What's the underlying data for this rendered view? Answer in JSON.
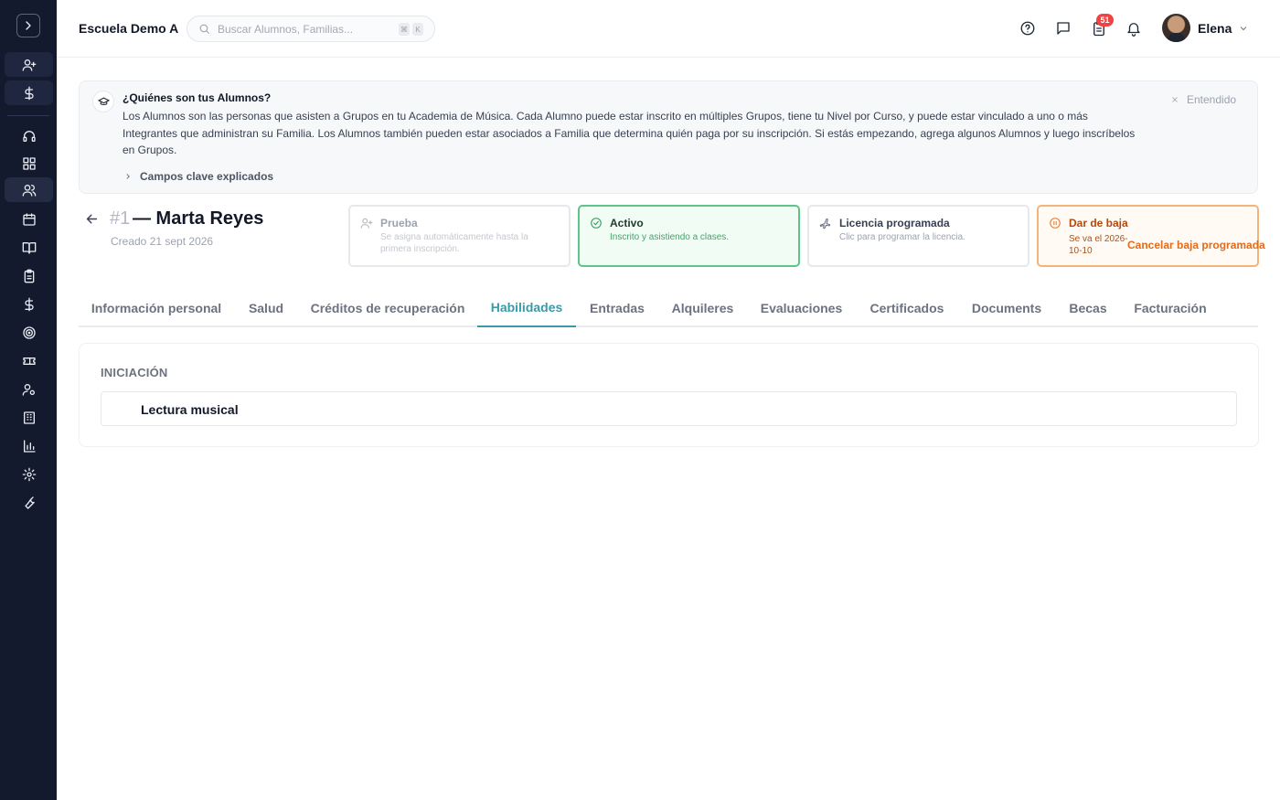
{
  "app": {
    "school_name": "Escuela Demo A",
    "search": {
      "placeholder": "Buscar Alumnos, Familias...",
      "shortcut_keys": [
        "⌘",
        "K"
      ]
    },
    "notifications_count": "51",
    "user": {
      "name": "Elena"
    }
  },
  "sidebar": {
    "items": [
      {
        "icon": "user-plus-icon"
      },
      {
        "icon": "dollar-icon"
      },
      {
        "icon": "headset-icon"
      },
      {
        "icon": "dashboard-grid-icon"
      },
      {
        "icon": "users-icon",
        "active": true
      },
      {
        "icon": "calendar-icon"
      },
      {
        "icon": "book-open-icon"
      },
      {
        "icon": "clipboard-icon"
      },
      {
        "icon": "dollar-icon"
      },
      {
        "icon": "target-icon"
      },
      {
        "icon": "ticket-icon"
      },
      {
        "icon": "user-settings-icon"
      },
      {
        "icon": "building-icon"
      },
      {
        "icon": "bar-chart-icon"
      },
      {
        "icon": "gear-icon"
      },
      {
        "icon": "wrench-icon"
      }
    ]
  },
  "banner": {
    "title": "¿Quiénes son tus Alumnos?",
    "body": "Los Alumnos son las personas que asisten a Grupos en tu Academia de Música. Cada Alumno puede estar inscrito en múltiples Grupos, tiene tu Nivel por Curso, y puede estar vinculado a uno o más Integrantes que administran su Familia. Los Alumnos también pueden estar asociados a Familia que determina quién paga por su inscripción. Si estás empezando, agrega algunos Alumnos y luego inscríbelos en Grupos.",
    "expand_label": "Campos clave explicados",
    "dismiss_label": "Entendido"
  },
  "student": {
    "id": "#1",
    "name": "— Marta Reyes",
    "created": "Creado 21 sept 2026"
  },
  "status_cards": [
    {
      "title": "Prueba",
      "subtitle": "Se asigna automáticamente hasta la primera inscripción."
    },
    {
      "title": "Activo",
      "subtitle": "Inscrito y asistiendo a clases."
    },
    {
      "title": "Licencia programada",
      "subtitle": "Clic para programar la licencia."
    },
    {
      "title": "Dar de baja",
      "subtitle": "Se va el 2026-10-10",
      "action": "Cancelar baja programada"
    }
  ],
  "tabs": [
    {
      "label": "Información personal"
    },
    {
      "label": "Salud"
    },
    {
      "label": "Créditos de recuperación"
    },
    {
      "label": "Habilidades",
      "active": true
    },
    {
      "label": "Entradas"
    },
    {
      "label": "Alquileres"
    },
    {
      "label": "Evaluaciones"
    },
    {
      "label": "Certificados"
    },
    {
      "label": "Documents"
    },
    {
      "label": "Becas"
    },
    {
      "label": "Facturación"
    }
  ],
  "skills": {
    "level": "INICIACIÓN",
    "items": [
      "Lectura musical"
    ]
  },
  "colors": {
    "sidebar_bg": "#141a2e",
    "accent_tab": "#3a9aa6",
    "active_green": "#5dc48a",
    "drop_orange": "#e56a19",
    "badge_red": "#ef4444"
  }
}
